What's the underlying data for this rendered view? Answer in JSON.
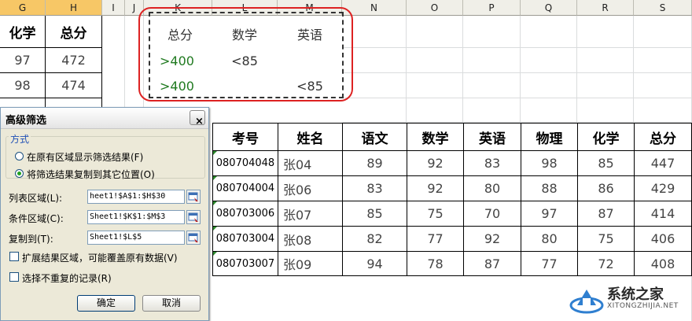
{
  "columns": [
    "G",
    "H",
    "I",
    "J",
    "K",
    "L",
    "M",
    "N",
    "O",
    "P",
    "Q",
    "R",
    "S"
  ],
  "left_table": {
    "headers": [
      "化学",
      "总分"
    ],
    "rows": [
      [
        "97",
        "472"
      ],
      [
        "98",
        "474"
      ]
    ]
  },
  "criteria": {
    "headers": [
      "总分",
      "数学",
      "英语"
    ],
    "rows": [
      [
        ">400",
        "<85",
        ""
      ],
      [
        ">400",
        "",
        "<85"
      ]
    ]
  },
  "result_table": {
    "headers": [
      "考号",
      "姓名",
      "语文",
      "数学",
      "英语",
      "物理",
      "化学",
      "总分"
    ],
    "rows": [
      [
        "080704048",
        "张04",
        "89",
        "92",
        "83",
        "98",
        "85",
        "447"
      ],
      [
        "080704004",
        "张06",
        "83",
        "92",
        "80",
        "88",
        "86",
        "429"
      ],
      [
        "080703006",
        "张07",
        "85",
        "75",
        "70",
        "97",
        "87",
        "414"
      ],
      [
        "080703004",
        "张08",
        "82",
        "77",
        "92",
        "80",
        "75",
        "406"
      ],
      [
        "080703007",
        "张09",
        "94",
        "78",
        "87",
        "77",
        "72",
        "408"
      ]
    ]
  },
  "dialog": {
    "title": "高级筛选",
    "close": "×",
    "group_label": "方式",
    "option1": "在原有区域显示筛选结果(F)",
    "option2": "将筛选结果复制到其它位置(O)",
    "list_label": "列表区域(L):",
    "list_value": "heet1!$A$1:$H$30",
    "criteria_label": "条件区域(C):",
    "criteria_value": "Sheet1!$K$1:$M$3",
    "copyto_label": "复制到(T):",
    "copyto_value": "Sheet1!$L$5",
    "expand_label": "扩展结果区域，可能覆盖原有数据(V)",
    "unique_label": "选择不重复的记录(R)",
    "ok": "确定",
    "cancel": "取消"
  },
  "watermark": {
    "title": "系统之家",
    "url": "XITONGZHIJIA.NET"
  },
  "colors": {
    "highlight_box": "#dd2222",
    "selected_header": "#f7c766",
    "header_bg": "#f0efe8"
  }
}
